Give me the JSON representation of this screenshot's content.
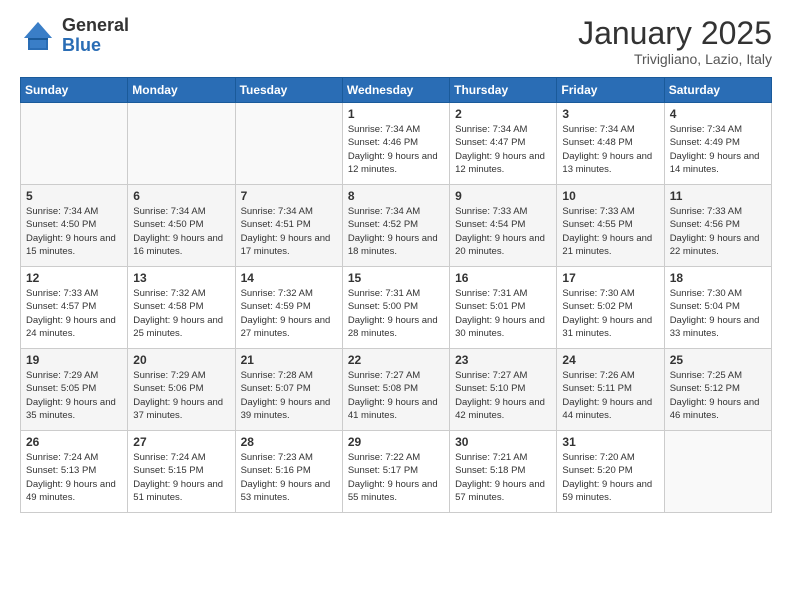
{
  "logo": {
    "general": "General",
    "blue": "Blue"
  },
  "header": {
    "month": "January 2025",
    "location": "Trivigliano, Lazio, Italy"
  },
  "weekdays": [
    "Sunday",
    "Monday",
    "Tuesday",
    "Wednesday",
    "Thursday",
    "Friday",
    "Saturday"
  ],
  "weeks": [
    [
      {
        "day": "",
        "sunrise": "",
        "sunset": "",
        "daylight": ""
      },
      {
        "day": "",
        "sunrise": "",
        "sunset": "",
        "daylight": ""
      },
      {
        "day": "",
        "sunrise": "",
        "sunset": "",
        "daylight": ""
      },
      {
        "day": "1",
        "sunrise": "Sunrise: 7:34 AM",
        "sunset": "Sunset: 4:46 PM",
        "daylight": "Daylight: 9 hours and 12 minutes."
      },
      {
        "day": "2",
        "sunrise": "Sunrise: 7:34 AM",
        "sunset": "Sunset: 4:47 PM",
        "daylight": "Daylight: 9 hours and 12 minutes."
      },
      {
        "day": "3",
        "sunrise": "Sunrise: 7:34 AM",
        "sunset": "Sunset: 4:48 PM",
        "daylight": "Daylight: 9 hours and 13 minutes."
      },
      {
        "day": "4",
        "sunrise": "Sunrise: 7:34 AM",
        "sunset": "Sunset: 4:49 PM",
        "daylight": "Daylight: 9 hours and 14 minutes."
      }
    ],
    [
      {
        "day": "5",
        "sunrise": "Sunrise: 7:34 AM",
        "sunset": "Sunset: 4:50 PM",
        "daylight": "Daylight: 9 hours and 15 minutes."
      },
      {
        "day": "6",
        "sunrise": "Sunrise: 7:34 AM",
        "sunset": "Sunset: 4:50 PM",
        "daylight": "Daylight: 9 hours and 16 minutes."
      },
      {
        "day": "7",
        "sunrise": "Sunrise: 7:34 AM",
        "sunset": "Sunset: 4:51 PM",
        "daylight": "Daylight: 9 hours and 17 minutes."
      },
      {
        "day": "8",
        "sunrise": "Sunrise: 7:34 AM",
        "sunset": "Sunset: 4:52 PM",
        "daylight": "Daylight: 9 hours and 18 minutes."
      },
      {
        "day": "9",
        "sunrise": "Sunrise: 7:33 AM",
        "sunset": "Sunset: 4:54 PM",
        "daylight": "Daylight: 9 hours and 20 minutes."
      },
      {
        "day": "10",
        "sunrise": "Sunrise: 7:33 AM",
        "sunset": "Sunset: 4:55 PM",
        "daylight": "Daylight: 9 hours and 21 minutes."
      },
      {
        "day": "11",
        "sunrise": "Sunrise: 7:33 AM",
        "sunset": "Sunset: 4:56 PM",
        "daylight": "Daylight: 9 hours and 22 minutes."
      }
    ],
    [
      {
        "day": "12",
        "sunrise": "Sunrise: 7:33 AM",
        "sunset": "Sunset: 4:57 PM",
        "daylight": "Daylight: 9 hours and 24 minutes."
      },
      {
        "day": "13",
        "sunrise": "Sunrise: 7:32 AM",
        "sunset": "Sunset: 4:58 PM",
        "daylight": "Daylight: 9 hours and 25 minutes."
      },
      {
        "day": "14",
        "sunrise": "Sunrise: 7:32 AM",
        "sunset": "Sunset: 4:59 PM",
        "daylight": "Daylight: 9 hours and 27 minutes."
      },
      {
        "day": "15",
        "sunrise": "Sunrise: 7:31 AM",
        "sunset": "Sunset: 5:00 PM",
        "daylight": "Daylight: 9 hours and 28 minutes."
      },
      {
        "day": "16",
        "sunrise": "Sunrise: 7:31 AM",
        "sunset": "Sunset: 5:01 PM",
        "daylight": "Daylight: 9 hours and 30 minutes."
      },
      {
        "day": "17",
        "sunrise": "Sunrise: 7:30 AM",
        "sunset": "Sunset: 5:02 PM",
        "daylight": "Daylight: 9 hours and 31 minutes."
      },
      {
        "day": "18",
        "sunrise": "Sunrise: 7:30 AM",
        "sunset": "Sunset: 5:04 PM",
        "daylight": "Daylight: 9 hours and 33 minutes."
      }
    ],
    [
      {
        "day": "19",
        "sunrise": "Sunrise: 7:29 AM",
        "sunset": "Sunset: 5:05 PM",
        "daylight": "Daylight: 9 hours and 35 minutes."
      },
      {
        "day": "20",
        "sunrise": "Sunrise: 7:29 AM",
        "sunset": "Sunset: 5:06 PM",
        "daylight": "Daylight: 9 hours and 37 minutes."
      },
      {
        "day": "21",
        "sunrise": "Sunrise: 7:28 AM",
        "sunset": "Sunset: 5:07 PM",
        "daylight": "Daylight: 9 hours and 39 minutes."
      },
      {
        "day": "22",
        "sunrise": "Sunrise: 7:27 AM",
        "sunset": "Sunset: 5:08 PM",
        "daylight": "Daylight: 9 hours and 41 minutes."
      },
      {
        "day": "23",
        "sunrise": "Sunrise: 7:27 AM",
        "sunset": "Sunset: 5:10 PM",
        "daylight": "Daylight: 9 hours and 42 minutes."
      },
      {
        "day": "24",
        "sunrise": "Sunrise: 7:26 AM",
        "sunset": "Sunset: 5:11 PM",
        "daylight": "Daylight: 9 hours and 44 minutes."
      },
      {
        "day": "25",
        "sunrise": "Sunrise: 7:25 AM",
        "sunset": "Sunset: 5:12 PM",
        "daylight": "Daylight: 9 hours and 46 minutes."
      }
    ],
    [
      {
        "day": "26",
        "sunrise": "Sunrise: 7:24 AM",
        "sunset": "Sunset: 5:13 PM",
        "daylight": "Daylight: 9 hours and 49 minutes."
      },
      {
        "day": "27",
        "sunrise": "Sunrise: 7:24 AM",
        "sunset": "Sunset: 5:15 PM",
        "daylight": "Daylight: 9 hours and 51 minutes."
      },
      {
        "day": "28",
        "sunrise": "Sunrise: 7:23 AM",
        "sunset": "Sunset: 5:16 PM",
        "daylight": "Daylight: 9 hours and 53 minutes."
      },
      {
        "day": "29",
        "sunrise": "Sunrise: 7:22 AM",
        "sunset": "Sunset: 5:17 PM",
        "daylight": "Daylight: 9 hours and 55 minutes."
      },
      {
        "day": "30",
        "sunrise": "Sunrise: 7:21 AM",
        "sunset": "Sunset: 5:18 PM",
        "daylight": "Daylight: 9 hours and 57 minutes."
      },
      {
        "day": "31",
        "sunrise": "Sunrise: 7:20 AM",
        "sunset": "Sunset: 5:20 PM",
        "daylight": "Daylight: 9 hours and 59 minutes."
      },
      {
        "day": "",
        "sunrise": "",
        "sunset": "",
        "daylight": ""
      }
    ]
  ]
}
